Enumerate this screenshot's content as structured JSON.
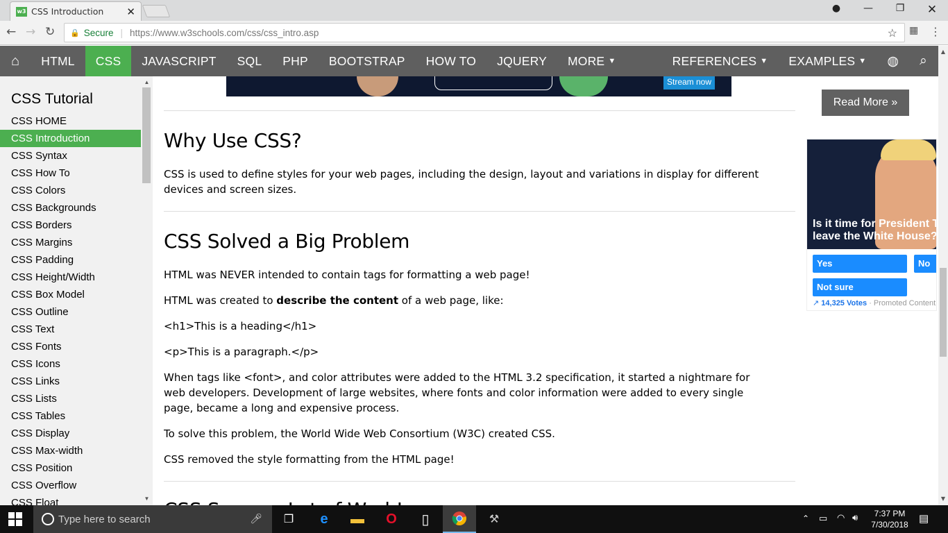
{
  "browser": {
    "tab_title": "CSS Introduction",
    "tab_favicon": "w3",
    "address": {
      "secure_label": "Secure",
      "url_host": "https://www.w3schools.com",
      "url_path": "/css/css_intro.asp"
    }
  },
  "topnav": {
    "items": [
      {
        "label": "HTML"
      },
      {
        "label": "CSS",
        "active": true
      },
      {
        "label": "JAVASCRIPT"
      },
      {
        "label": "SQL"
      },
      {
        "label": "PHP"
      },
      {
        "label": "BOOTSTRAP"
      },
      {
        "label": "HOW TO"
      },
      {
        "label": "JQUERY"
      },
      {
        "label": "MORE"
      }
    ],
    "right_items": [
      {
        "label": "REFERENCES"
      },
      {
        "label": "EXAMPLES"
      }
    ],
    "caret": "▼",
    "active_color": "#4caf50",
    "bar_color": "#5f5f5f"
  },
  "sidebar": {
    "title": "CSS Tutorial",
    "items": [
      "CSS HOME",
      "CSS Introduction",
      "CSS Syntax",
      "CSS How To",
      "CSS Colors",
      "CSS Backgrounds",
      "CSS Borders",
      "CSS Margins",
      "CSS Padding",
      "CSS Height/Width",
      "CSS Box Model",
      "CSS Outline",
      "CSS Text",
      "CSS Fonts",
      "CSS Icons",
      "CSS Links",
      "CSS Lists",
      "CSS Tables",
      "CSS Display",
      "CSS Max-width",
      "CSS Position",
      "CSS Overflow",
      "CSS Float"
    ],
    "active_index": 1
  },
  "main": {
    "banner_button": "Stream now",
    "section1": {
      "heading": "Why Use CSS?",
      "text": "CSS is used to define styles for your web pages, including the design, layout and variations in display for different devices and screen sizes."
    },
    "section2": {
      "heading": "CSS Solved a Big Problem",
      "p1": "HTML was NEVER intended to contain tags for formatting a web page!",
      "p2_before": "HTML was created to ",
      "p2_bold": "describe the content",
      "p2_after": " of a web page, like:",
      "code1": "<h1>This is a heading</h1>",
      "code2": "<p>This is a paragraph.</p>",
      "p3": "When tags like <font>, and color attributes were added to the HTML 3.2 specification, it started a nightmare for web developers. Development of large websites, where fonts and color information were added to every single page, became a long and expensive process.",
      "p4": "To solve this problem, the World Wide Web Consortium (W3C) created CSS.",
      "p5": "CSS removed the style formatting from the HTML page!"
    },
    "section3_partial_heading": "CSS Saves a Lot of Work!"
  },
  "right": {
    "read_more": "Read More »",
    "ad": {
      "question": "Is it time for President T leave the White House?",
      "question_line1": "Is it time for President T",
      "question_line2": "leave the White House?",
      "buttons": [
        "Yes",
        "No",
        "Not sure"
      ],
      "votes": "14,325 Votes",
      "promoted": "· Promoted Content"
    }
  },
  "taskbar": {
    "search_placeholder": "Type here to search",
    "time": "7:37 PM",
    "date": "7/30/2018"
  }
}
